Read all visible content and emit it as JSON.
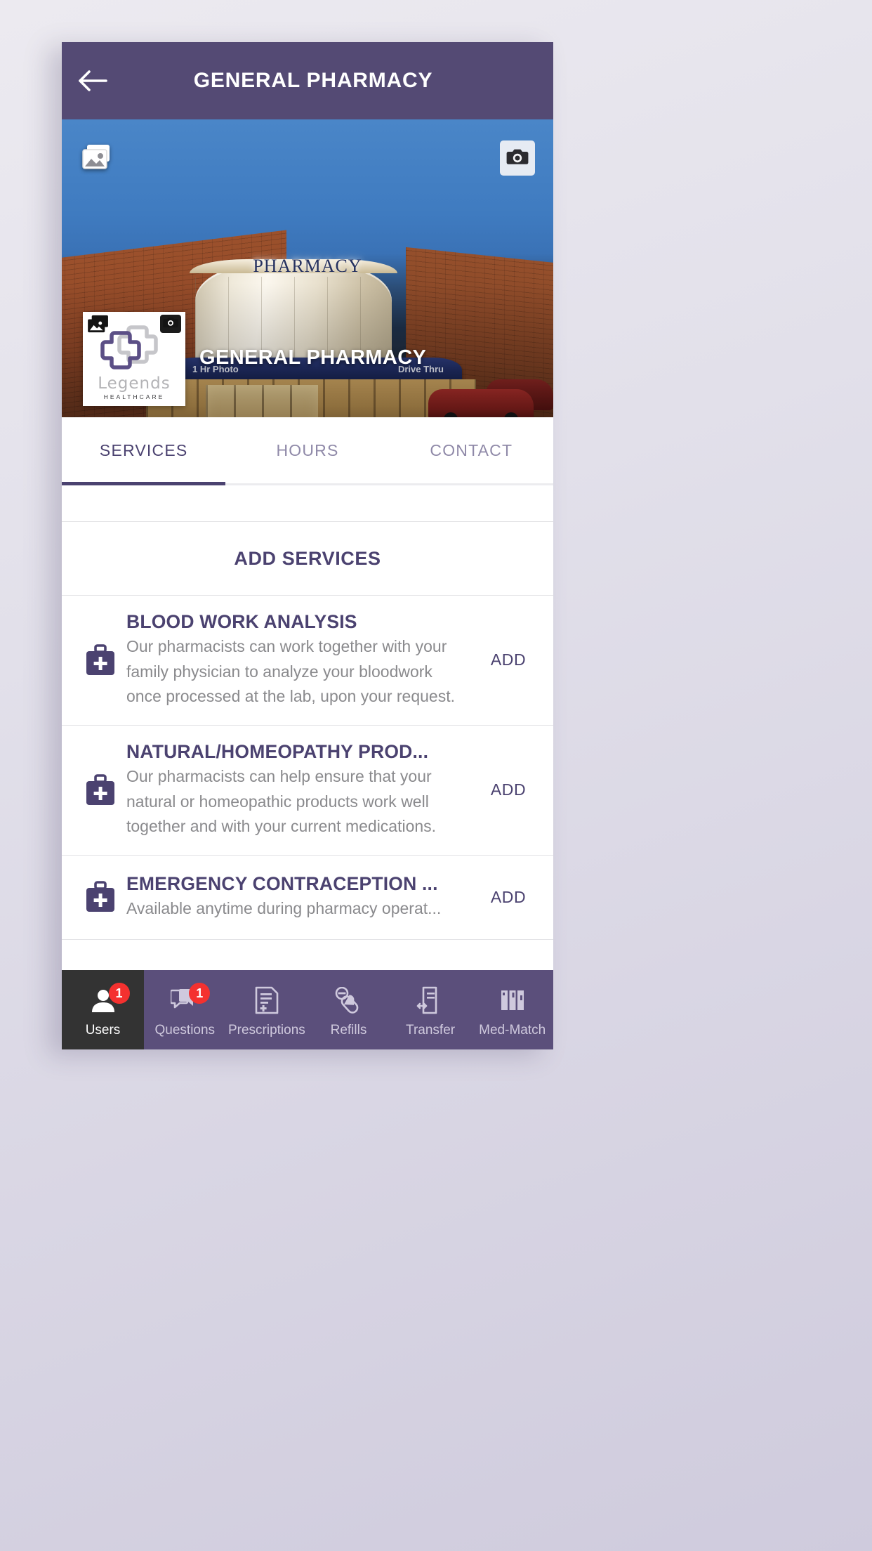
{
  "appbar": {
    "title": "GENERAL PHARMACY",
    "back_icon": "arrow-left-icon"
  },
  "hero": {
    "gallery_icon": "gallery-icon",
    "camera_icon": "camera-icon",
    "store_name": "GENERAL PHARMACY",
    "sign_text": "PHARMACY",
    "awning_left": "1 Hr Photo",
    "awning_right": "Drive Thru",
    "logo": {
      "word": "Legends",
      "sub": "HEALTHCARE",
      "gallery_icon": "gallery-icon",
      "camera_icon": "camera-icon"
    }
  },
  "tabs": [
    {
      "label": "SERVICES",
      "active": true
    },
    {
      "label": "HOURS",
      "active": false
    },
    {
      "label": "CONTACT",
      "active": false
    }
  ],
  "add_services": {
    "label": "ADD SERVICES"
  },
  "services": [
    {
      "title": "BLOOD WORK ANALYSIS",
      "description": "Our pharmacists can work together with your family physician to analyze your bloodwork once processed at the lab, upon your request.",
      "action": "ADD",
      "icon": "medical-bag-icon"
    },
    {
      "title": "NATURAL/HOMEOPATHY PROD...",
      "description": "Our pharmacists can help ensure that your natural or homeopathic products work well together and with your current medications.",
      "action": "ADD",
      "icon": "medical-bag-icon"
    },
    {
      "title": "EMERGENCY CONTRACEPTION ...",
      "description": "Available anytime during pharmacy operat...",
      "action": "ADD",
      "icon": "medical-bag-icon"
    }
  ],
  "bottom_nav": [
    {
      "label": "Users",
      "icon": "user-icon",
      "badge": "1",
      "active": true
    },
    {
      "label": "Questions",
      "icon": "chat-bubbles-icon",
      "badge": "1",
      "active": false
    },
    {
      "label": "Prescriptions",
      "icon": "document-plus-icon",
      "badge": null,
      "active": false
    },
    {
      "label": "Refills",
      "icon": "pills-icon",
      "badge": null,
      "active": false
    },
    {
      "label": "Transfer",
      "icon": "document-transfer-icon",
      "badge": null,
      "active": false
    },
    {
      "label": "Med-Match",
      "icon": "pill-bottles-icon",
      "badge": null,
      "active": false
    }
  ],
  "colors": {
    "appbar": "#544a74",
    "accent": "#4b4270",
    "nav_bar": "#5b4f7b",
    "nav_active": "#333333",
    "badge": "#f4312f",
    "muted_text": "#8a8a8d"
  }
}
